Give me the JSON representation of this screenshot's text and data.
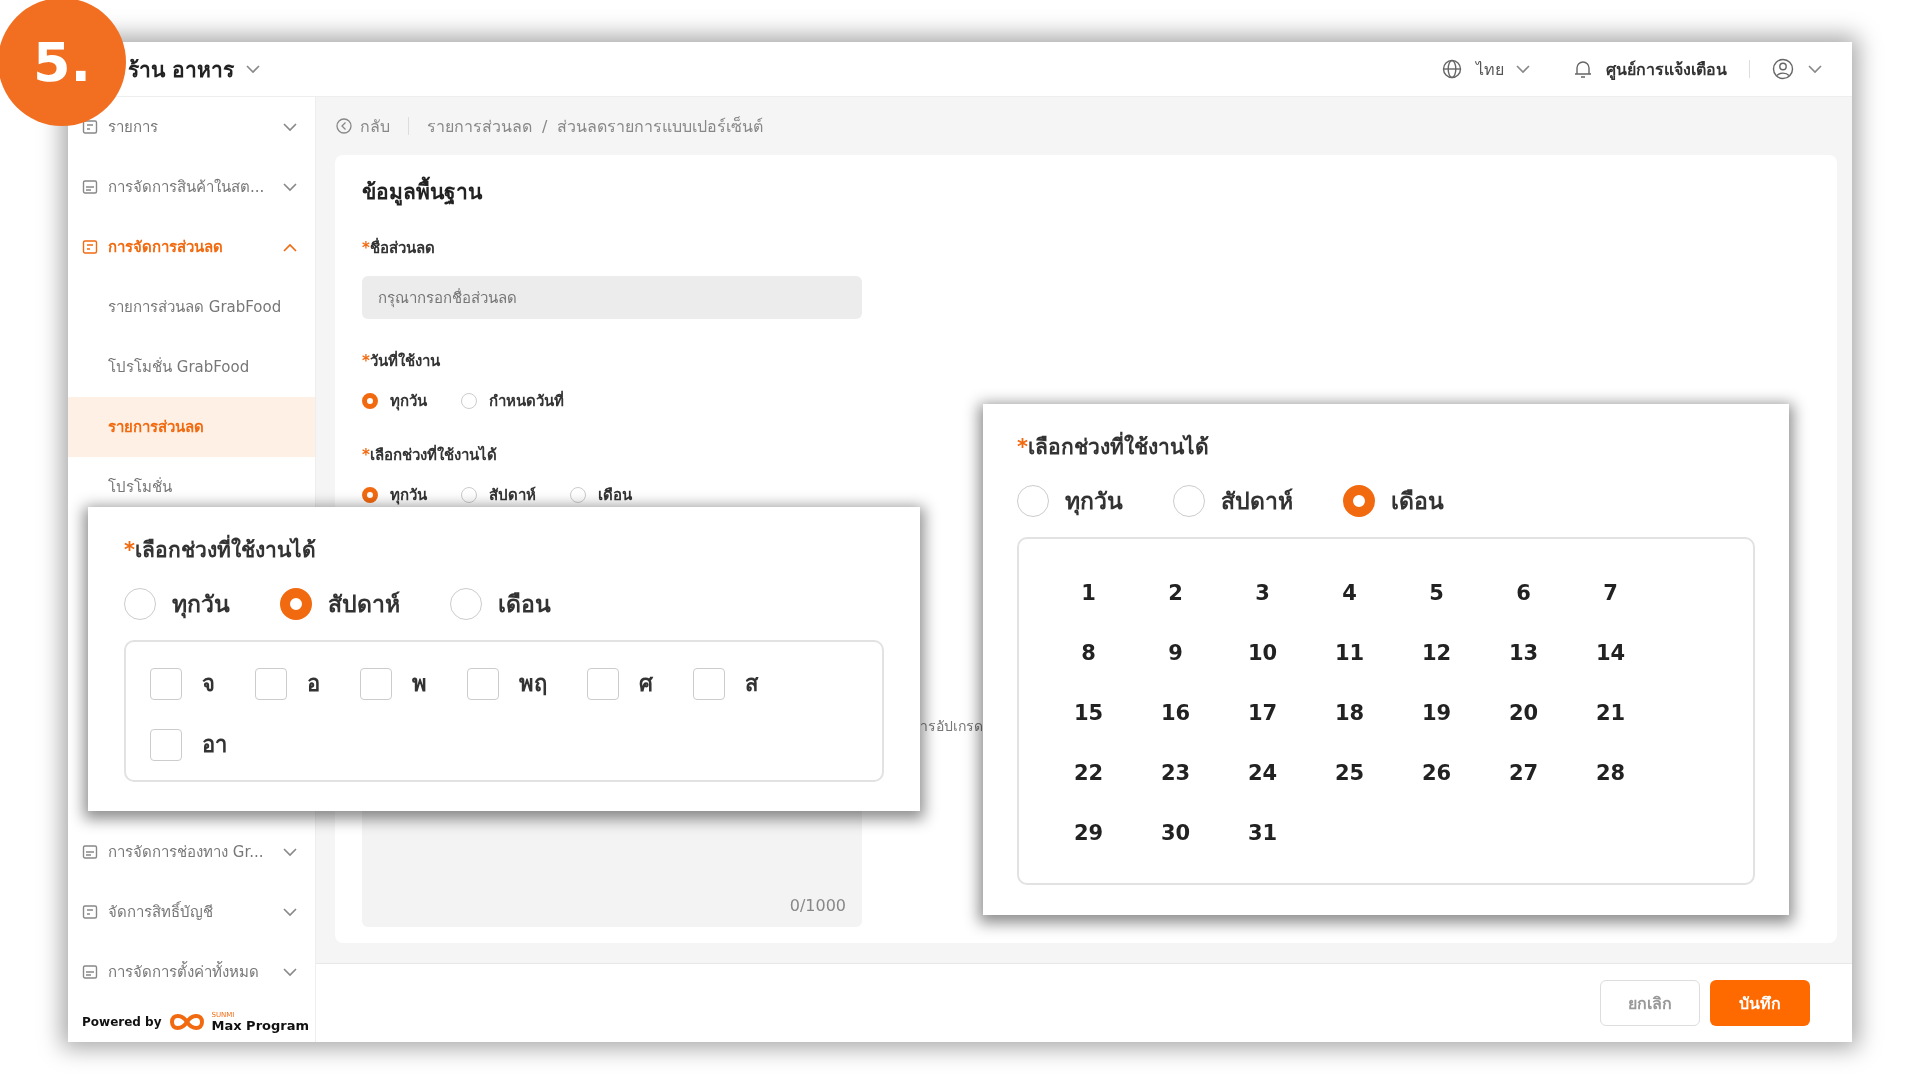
{
  "badge": "5.",
  "header": {
    "store": "ร้าน อาหาร",
    "language": "ไทย",
    "notifications": "ศูนย์การแจ้งเตือน"
  },
  "sidebar": {
    "items": [
      {
        "label": "รายการ",
        "expanded": false
      },
      {
        "label": "การจัดการสินค้าในสต...",
        "expanded": false
      },
      {
        "label": "การจัดการส่วนลด",
        "expanded": true,
        "children": [
          {
            "label": "รายการส่วนลด GrabFood",
            "selected": false
          },
          {
            "label": "โปรโมชั่น GrabFood",
            "selected": false
          },
          {
            "label": "รายการส่วนลด",
            "selected": true
          },
          {
            "label": "โปรโมชั่น",
            "selected": false
          }
        ]
      }
    ],
    "bottom_items": [
      {
        "label": "การจัดการช่องทาง Gr...",
        "expanded": false
      },
      {
        "label": "จัดการสิทธิ์บัญชี",
        "expanded": false
      },
      {
        "label": "การจัดการตั้งค่าทั้งหมด",
        "expanded": false
      }
    ],
    "powered_by": "Powered by",
    "logo_small": "SUNMI",
    "logo_text": "Max Program"
  },
  "breadcrumb": {
    "back": "กลับ",
    "items": [
      "รายการส่วนลด",
      "ส่วนลดรายการแบบเปอร์เซ็นต์"
    ],
    "separator": "/"
  },
  "form": {
    "title": "ข้อมูลพื้นฐาน",
    "name_field": {
      "mark": "*",
      "label": "ชื่อส่วนลด",
      "placeholder": "กรุณากรอกชื่อส่วนลด"
    },
    "usage_date": {
      "mark": "*",
      "label": "วันที่ใช้งาน",
      "options": [
        {
          "label": "ทุกวัน",
          "selected": true
        },
        {
          "label": "กำหนดวันที่",
          "selected": false
        }
      ]
    },
    "period": {
      "mark": "*",
      "label": "เลือกช่วงที่ใช้งานได้",
      "options": [
        {
          "label": "ทุกวัน",
          "selected": true
        },
        {
          "label": "สัปดาห์",
          "selected": false
        },
        {
          "label": "เดือน",
          "selected": false
        }
      ]
    },
    "partial_text": "ารอัปเกรด",
    "counter": "0/1000"
  },
  "callouts": [
    {
      "kind": "weekly",
      "mark": "*",
      "label": "เลือกช่วงที่ใช้งานได้",
      "options": [
        {
          "label": "ทุกวัน",
          "selected": false
        },
        {
          "label": "สัปดาห์",
          "selected": true
        },
        {
          "label": "เดือน",
          "selected": false
        }
      ],
      "days": [
        {
          "label": "จ",
          "checked": false
        },
        {
          "label": "อ",
          "checked": false
        },
        {
          "label": "พ",
          "checked": false
        },
        {
          "label": "พฤ",
          "checked": false
        },
        {
          "label": "ศ",
          "checked": false
        },
        {
          "label": "ส",
          "checked": false
        },
        {
          "label": "อา",
          "checked": false
        }
      ]
    },
    {
      "kind": "monthly",
      "mark": "*",
      "label": "เลือกช่วงที่ใช้งานได้",
      "options": [
        {
          "label": "ทุกวัน",
          "selected": false
        },
        {
          "label": "สัปดาห์",
          "selected": false
        },
        {
          "label": "เดือน",
          "selected": true
        }
      ],
      "dates": [
        "1",
        "2",
        "3",
        "4",
        "5",
        "6",
        "7",
        "8",
        "9",
        "10",
        "11",
        "12",
        "13",
        "14",
        "15",
        "16",
        "17",
        "18",
        "19",
        "20",
        "21",
        "22",
        "23",
        "24",
        "25",
        "26",
        "27",
        "28",
        "29",
        "30",
        "31"
      ]
    }
  ],
  "footer": {
    "cancel": "ยกเลิก",
    "save": "บันทึก"
  }
}
